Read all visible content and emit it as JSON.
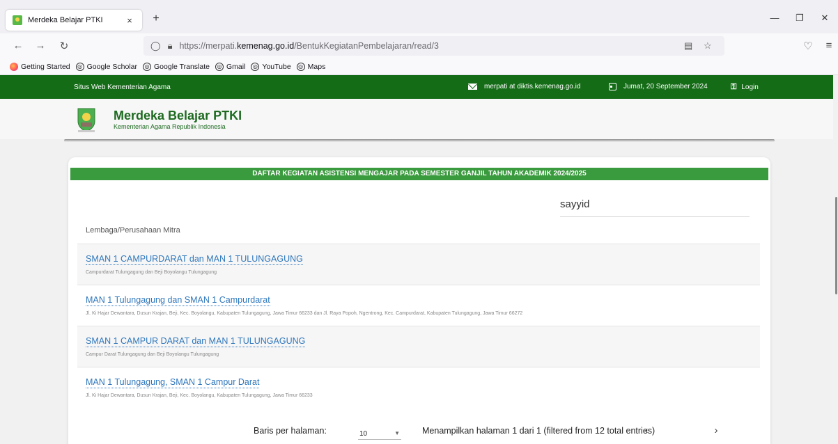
{
  "browser": {
    "tab_title": "Merdeka Belajar PTKI",
    "tab_close": "×",
    "new_tab": "+",
    "url_prefix": "https://merpati.",
    "url_domain": "kemenag.go.id",
    "url_path": "/BentukKegiatanPembelajaran/read/3",
    "bookmarks": [
      "Getting Started",
      "Google Scholar",
      "Google Translate",
      "Gmail",
      "YouTube",
      "Maps"
    ]
  },
  "topbar": {
    "site": "Situs Web Kementerian Agama",
    "email": "merpati at diktis.kemenag.go.id",
    "date": "Jumat, 20 September 2024",
    "login": "Login",
    "bg_color": "#146c17"
  },
  "header": {
    "title": "Merdeka Belajar PTKI",
    "subtitle": "Kementerian Agama Republik Indonesia"
  },
  "card": {
    "heading": "DAFTAR KEGIATAN ASISTENSI MENGAJAR PADA SEMESTER GANJIL TAHUN AKADEMIK 2024/2025",
    "search_value": "sayyid",
    "column_header": "Lembaga/Perusahaan Mitra",
    "rows": [
      {
        "title": "SMAN 1 CAMPURDARAT dan MAN 1 TULUNGAGUNG",
        "subtitle": "Campurdarat Tulungagung dan Beji Boyolangu Tulungagung"
      },
      {
        "title": "MAN 1 Tulungagung dan SMAN 1 Campurdarat",
        "subtitle": "Jl. Ki Hajar Dewantara, Dusun Krajan, Beji, Kec. Boyolangu, Kabupaten Tulungagung, Jawa Timur 66233 dan Jl. Raya Popoh, Ngentrong, Kec. Campurdarat, Kabupaten Tulungagung, Jawa Timur 66272"
      },
      {
        "title": "SMAN 1 CAMPUR DARAT dan MAN 1 TULUNGAGUNG",
        "subtitle": "Campur Darat Tulungagung dan Beji Boyolangu Tulungagung"
      },
      {
        "title": "MAN 1 Tulungagung, SMAN 1 Campur Darat",
        "subtitle": "Jl. Ki Hajar Dewantara, Dusun Krajan, Beji, Kec. Boyolangu, Kabupaten Tulungagung, Jawa Timur 66233"
      }
    ],
    "pager": {
      "rows_label": "Baris per halaman:",
      "rows_value": "10",
      "info": "Menampilkan halaman 1 dari 1 (filtered from 12 total entries)"
    }
  }
}
